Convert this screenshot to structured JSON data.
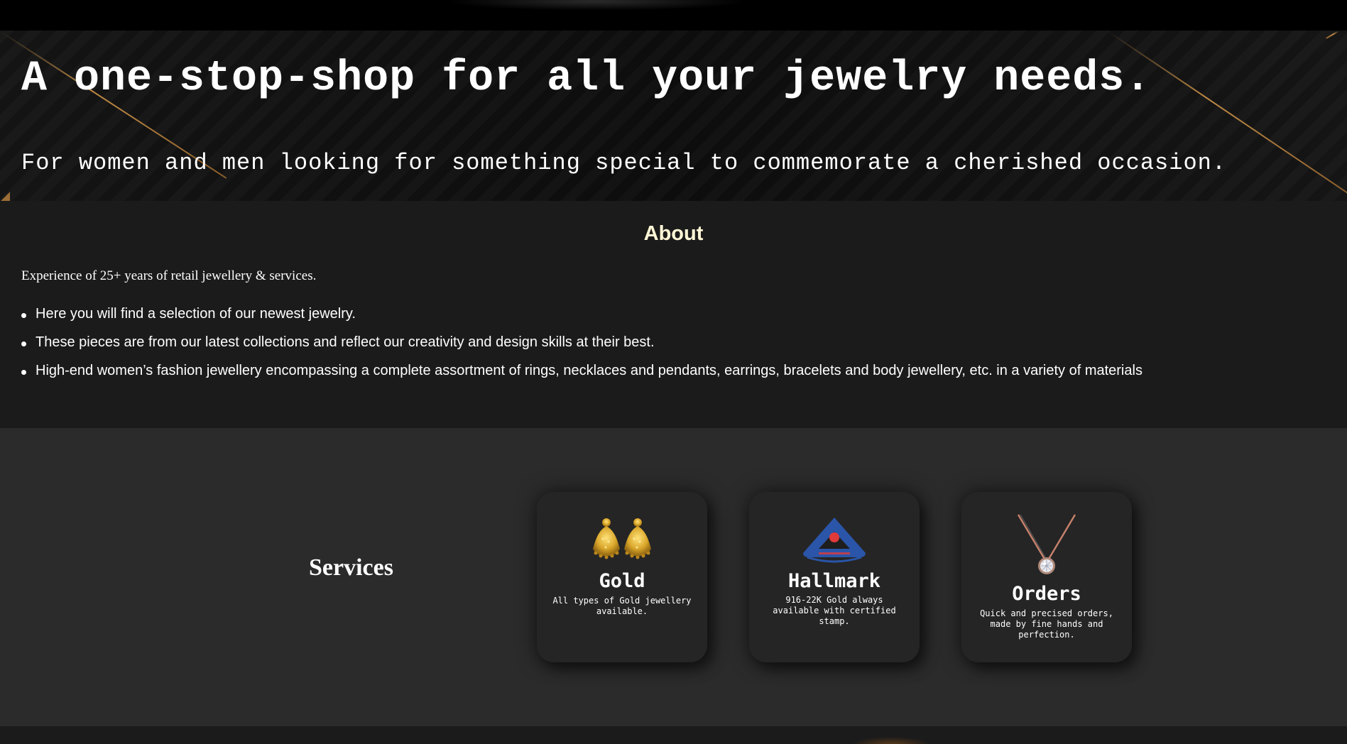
{
  "hero": {
    "title": "A one-stop-shop for all your jewelry needs.",
    "subtitle": "For women and men looking for something special to commemorate a cherished occasion."
  },
  "about": {
    "title": "About",
    "intro": "Experience of 25+ years of retail jewellery & services.",
    "items": [
      "Here you will find a selection of our newest jewelry.",
      "These pieces are from our latest collections and reflect our creativity and design skills at their best.",
      "High-end women’s fashion jewellery encompassing a complete assortment of rings, necklaces and pendants, earrings, bracelets and body jewellery, etc. in a variety of materials"
    ]
  },
  "services": {
    "title": "Services",
    "cards": [
      {
        "name": "Gold",
        "description": "All types of Gold jewellery available.",
        "icon": "gold-earrings-icon"
      },
      {
        "name": "Hallmark",
        "description": "916-22K Gold always available with certified stamp.",
        "icon": "hallmark-logo-icon"
      },
      {
        "name": "Orders",
        "description": "Quick and precised orders, made by fine hands and perfection.",
        "icon": "diamond-pendant-icon"
      }
    ]
  },
  "colors": {
    "accent_heading": "#fff7d6",
    "gold": "#c08a45",
    "page_bg": "#1b1b1b",
    "services_bg": "#2b2b2b",
    "card_bg": "#252525",
    "hallmark_blue": "#2a55a8",
    "hallmark_red": "#e03a3a"
  }
}
